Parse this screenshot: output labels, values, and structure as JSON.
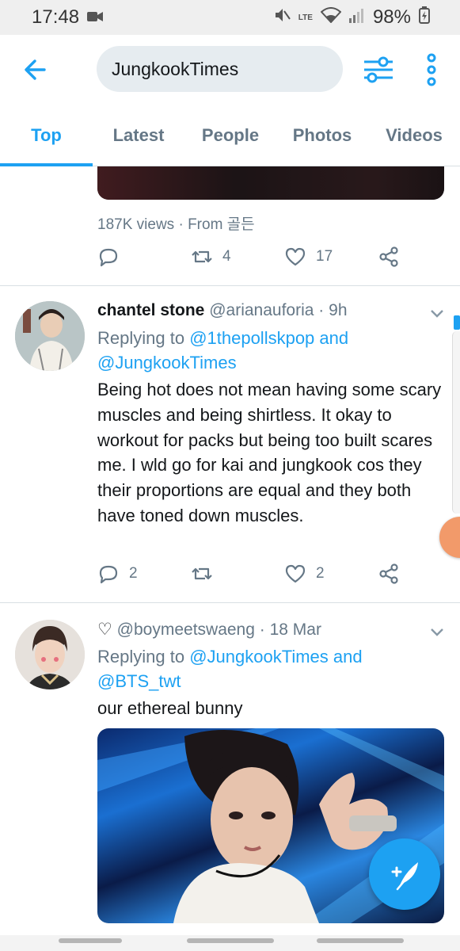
{
  "status_bar": {
    "time": "17:48",
    "battery": "98%",
    "lte": "LTE"
  },
  "search": {
    "query": "JungkookTimes"
  },
  "tabs": [
    {
      "label": "Top",
      "active": true
    },
    {
      "label": "Latest",
      "active": false
    },
    {
      "label": "People",
      "active": false
    },
    {
      "label": "Photos",
      "active": false
    },
    {
      "label": "Videos",
      "active": false
    }
  ],
  "prev_tweet": {
    "views": "187K views",
    "from": "From 골든",
    "retweets": "4",
    "likes": "17"
  },
  "tweet1": {
    "name": "chantel stone",
    "handle": "@arianauforia",
    "time": "9h",
    "replying_prefix": "Replying to ",
    "mention1": "@1thepollskpop",
    "and": " and",
    "mention2": "@JungkookTimes",
    "text": "Being hot does not mean having some scary muscles and being shirtless. It okay to workout for packs but being too built scares me. I wld go for kai and jungkook cos they their proportions are equal and they both have toned down muscles.",
    "replies": "2",
    "likes": "2"
  },
  "tweet2": {
    "name": "♡",
    "handle": "@boymeetswaeng",
    "time": "18 Mar",
    "replying_prefix": "Replying to ",
    "mention1": "@JungkookTimes",
    "and": " and",
    "mention2": "@BTS_twt",
    "text": "our ethereal bunny"
  },
  "colors": {
    "accent": "#1da1f2",
    "muted": "#657786",
    "text": "#14171a"
  }
}
